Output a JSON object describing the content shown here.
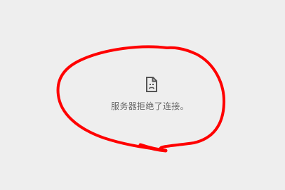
{
  "error": {
    "icon": "sad-document-icon",
    "message": "服务器拒绝了连接。"
  },
  "colors": {
    "background": "#eeeeee",
    "message_text": "#666666",
    "annotation": "#ff0000"
  }
}
